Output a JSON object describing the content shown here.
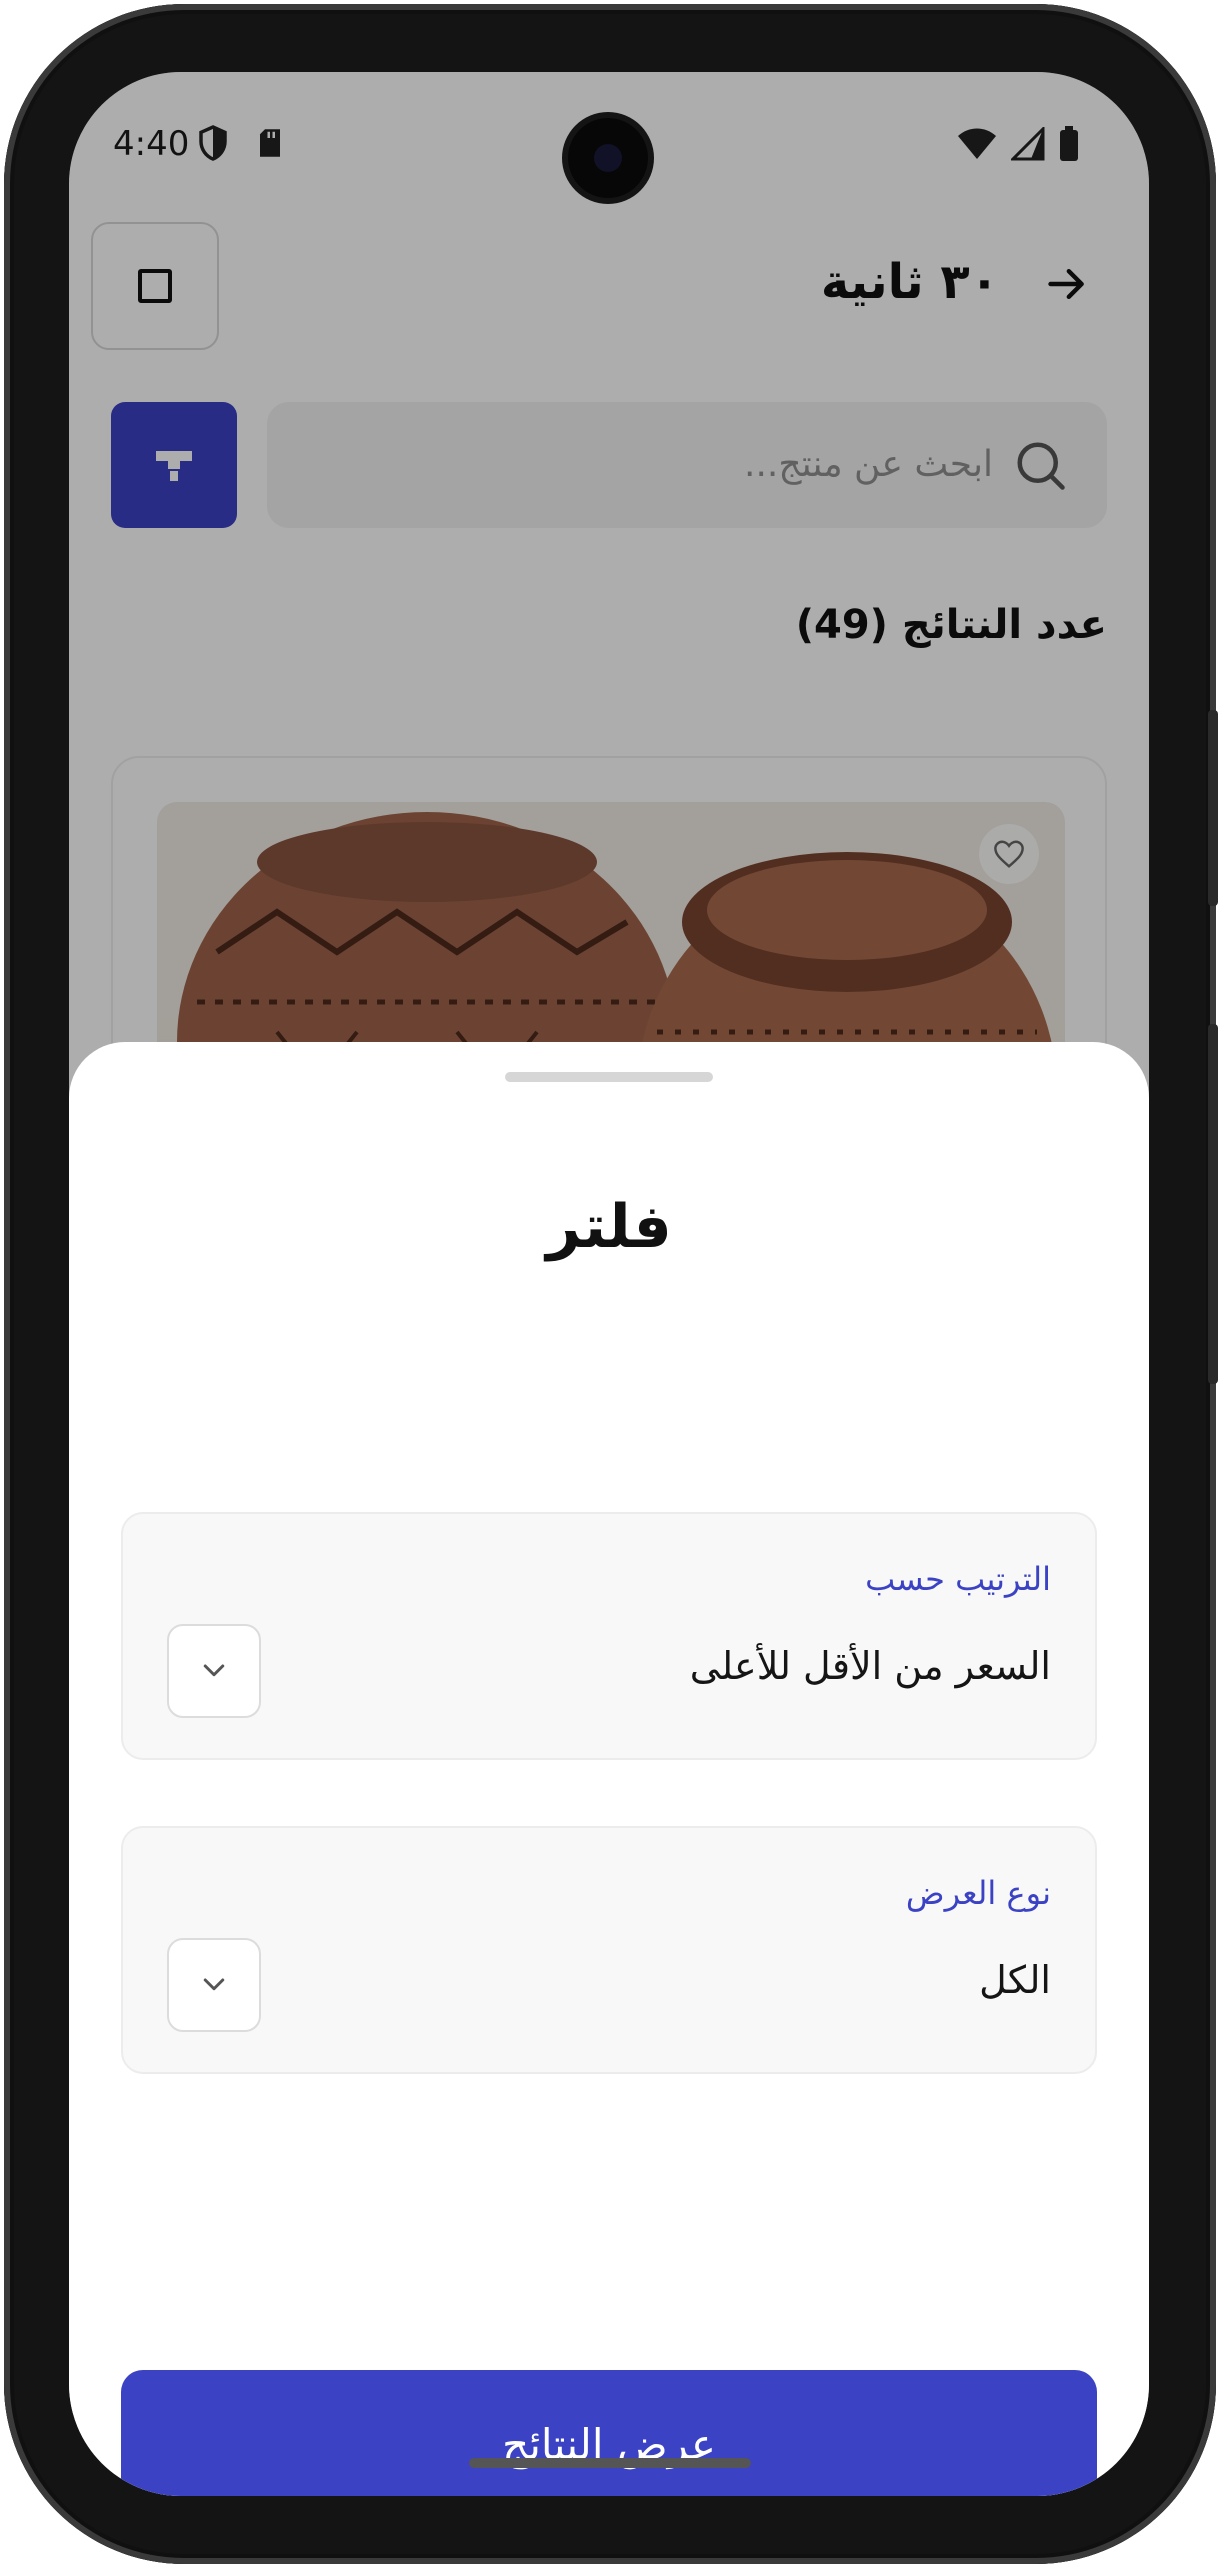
{
  "status_bar": {
    "time": "4:40",
    "icons": [
      "shield-icon",
      "sdcard-icon",
      "wifi-icon",
      "signal-icon",
      "battery-icon"
    ]
  },
  "header": {
    "title": "٣٠ ثانية",
    "back_icon": "arrow-right-icon",
    "square_button_icon": "square-icon"
  },
  "search": {
    "placeholder": "ابحث عن منتج...",
    "icon": "search-icon",
    "filter_icon": "filter-icon"
  },
  "results": {
    "count_label": "عدد النتائج (49)"
  },
  "product": {
    "favorite_icon": "heart-icon"
  },
  "filter_sheet": {
    "title": "فلتر",
    "fields": [
      {
        "label": "الترتيب حسب",
        "value": "السعر من الأقل للأعلى"
      },
      {
        "label": "نوع العرض",
        "value": "الكل"
      }
    ],
    "submit_label": "عرض النتائج"
  },
  "colors": {
    "accent": "#3b42c4",
    "scrim": "rgba(0,0,0,0.32)"
  }
}
